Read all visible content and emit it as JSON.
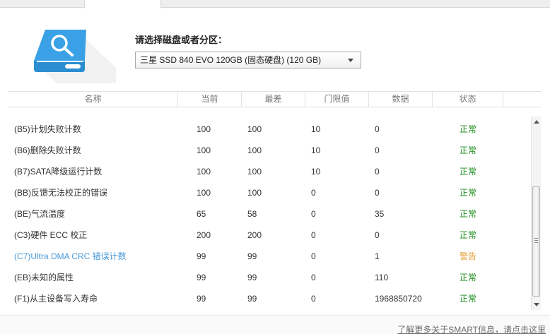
{
  "select_label": "请选择磁盘或者分区：",
  "disk_select": {
    "value": "三星  SSD 840 EVO 120GB (固态硬盘)  (120 GB)"
  },
  "table": {
    "headers": [
      "名称",
      "当前",
      "最差",
      "门限值",
      "数据",
      "状态"
    ],
    "rows": [
      {
        "name": "(B5)计划失败计数",
        "current": "100",
        "worst": "100",
        "threshold": "10",
        "data": "0",
        "status": "正常",
        "status_type": "ok"
      },
      {
        "name": "(B6)删除失败计数",
        "current": "100",
        "worst": "100",
        "threshold": "10",
        "data": "0",
        "status": "正常",
        "status_type": "ok"
      },
      {
        "name": "(B7)SATA降级运行计数",
        "current": "100",
        "worst": "100",
        "threshold": "10",
        "data": "0",
        "status": "正常",
        "status_type": "ok"
      },
      {
        "name": "(BB)反馈无法校正的错误",
        "current": "100",
        "worst": "100",
        "threshold": "0",
        "data": "0",
        "status": "正常",
        "status_type": "ok"
      },
      {
        "name": "(BE)气流温度",
        "current": "65",
        "worst": "58",
        "threshold": "0",
        "data": "35",
        "status": "正常",
        "status_type": "ok"
      },
      {
        "name": "(C3)硬件 ECC 校正",
        "current": "200",
        "worst": "200",
        "threshold": "0",
        "data": "0",
        "status": "正常",
        "status_type": "ok"
      },
      {
        "name": "(C7)Ultra DMA CRC 错误计数",
        "current": "99",
        "worst": "99",
        "threshold": "0",
        "data": "1",
        "status": "警告",
        "status_type": "warn"
      },
      {
        "name": "(EB)未知的属性",
        "current": "99",
        "worst": "99",
        "threshold": "0",
        "data": "110",
        "status": "正常",
        "status_type": "ok"
      },
      {
        "name": "(F1)从主设备写入寿命",
        "current": "99",
        "worst": "99",
        "threshold": "0",
        "data": "1968850720",
        "status": "正常",
        "status_type": "ok"
      }
    ]
  },
  "footer_link": "了解更多关于SMART信息，请点击这里",
  "colors": {
    "ok": "#1a8a1a",
    "warn": "#e6a23c",
    "highlight": "#4a9ad8",
    "icon_blue": "#3aa1e6"
  },
  "icons": {
    "disk": "hard-disk-search-icon"
  }
}
